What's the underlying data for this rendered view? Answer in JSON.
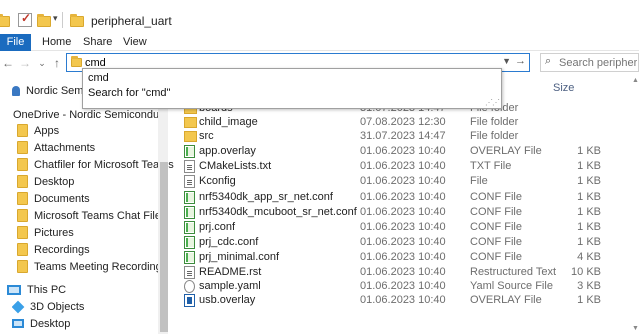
{
  "window": {
    "title": "peripheral_uart"
  },
  "ribbon": {
    "tabs": [
      "File",
      "Home",
      "Share",
      "View"
    ]
  },
  "address": {
    "value": "cmd"
  },
  "search": {
    "placeholder": "Search peripheral_uart"
  },
  "autocomplete": {
    "items": [
      "cmd",
      "Search for \"cmd\""
    ]
  },
  "columns": {
    "size": "Size"
  },
  "nav": {
    "items": [
      {
        "label": "Nordic Semicon"
      },
      {
        "label": "OneDrive - Nordic Semiconductor"
      },
      {
        "label": "Apps"
      },
      {
        "label": "Attachments"
      },
      {
        "label": "Chatfiler for Microsoft Teams"
      },
      {
        "label": "Desktop"
      },
      {
        "label": "Documents"
      },
      {
        "label": "Microsoft Teams Chat Files"
      },
      {
        "label": "Pictures"
      },
      {
        "label": "Recordings"
      },
      {
        "label": "Teams Meeting Recordings"
      },
      {
        "label": "This PC"
      },
      {
        "label": "3D Objects"
      },
      {
        "label": "Desktop"
      }
    ]
  },
  "files": [
    {
      "name": "boards",
      "date": "31.07.2023 14:47",
      "type": "File folder",
      "size": ""
    },
    {
      "name": "child_image",
      "date": "07.08.2023 12:30",
      "type": "File folder",
      "size": ""
    },
    {
      "name": "src",
      "date": "31.07.2023 14:47",
      "type": "File folder",
      "size": ""
    },
    {
      "name": "app.overlay",
      "date": "01.06.2023 10:40",
      "type": "OVERLAY File",
      "size": "1 KB"
    },
    {
      "name": "CMakeLists.txt",
      "date": "01.06.2023 10:40",
      "type": "TXT File",
      "size": "1 KB"
    },
    {
      "name": "Kconfig",
      "date": "01.06.2023 10:40",
      "type": "File",
      "size": "1 KB"
    },
    {
      "name": "nrf5340dk_app_sr_net.conf",
      "date": "01.06.2023 10:40",
      "type": "CONF File",
      "size": "1 KB"
    },
    {
      "name": "nrf5340dk_mcuboot_sr_net.conf",
      "date": "01.06.2023 10:40",
      "type": "CONF File",
      "size": "1 KB"
    },
    {
      "name": "prj.conf",
      "date": "01.06.2023 10:40",
      "type": "CONF File",
      "size": "1 KB"
    },
    {
      "name": "prj_cdc.conf",
      "date": "01.06.2023 10:40",
      "type": "CONF File",
      "size": "1 KB"
    },
    {
      "name": "prj_minimal.conf",
      "date": "01.06.2023 10:40",
      "type": "CONF File",
      "size": "4 KB"
    },
    {
      "name": "README.rst",
      "date": "01.06.2023 10:40",
      "type": "Restructured Text ...",
      "size": "10 KB"
    },
    {
      "name": "sample.yaml",
      "date": "01.06.2023 10:40",
      "type": "Yaml Source File",
      "size": "3 KB"
    },
    {
      "name": "usb.overlay",
      "date": "01.06.2023 10:40",
      "type": "OVERLAY File",
      "size": "1 KB"
    }
  ]
}
